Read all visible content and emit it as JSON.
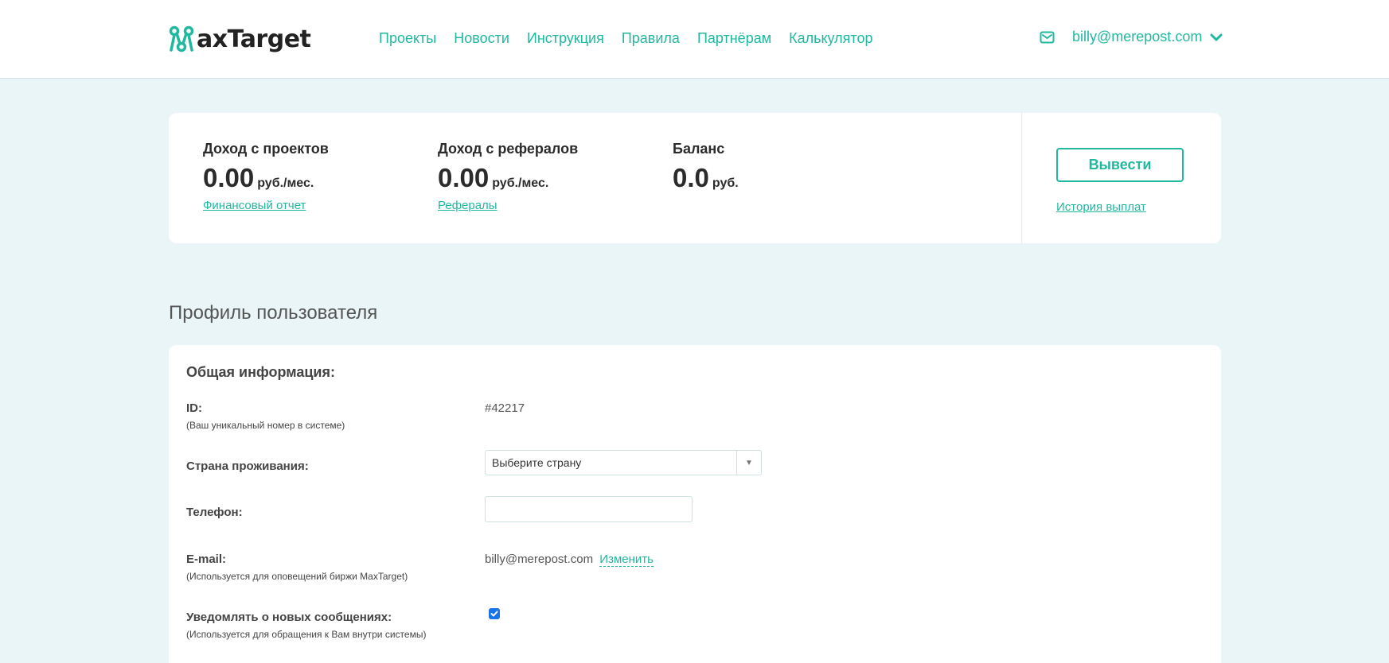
{
  "brand": {
    "logo_text": "axTarget",
    "accent": "#21b8a0",
    "page_bg": "#e9f5f6"
  },
  "nav": {
    "items": [
      {
        "label": "Проекты"
      },
      {
        "label": "Новости"
      },
      {
        "label": "Инструкция"
      },
      {
        "label": "Правила"
      },
      {
        "label": "Партнёрам"
      },
      {
        "label": "Калькулятор"
      }
    ]
  },
  "user": {
    "email": "billy@merepost.com",
    "mail_icon": "envelope-icon",
    "dropdown_icon": "chevron-down-icon"
  },
  "stats": {
    "projects": {
      "label": "Доход с проектов",
      "value": "0.00",
      "unit": "руб./мес.",
      "link": "Финансовый отчет"
    },
    "referrals": {
      "label": "Доход с рефералов",
      "value": "0.00",
      "unit": "руб./мес.",
      "link": "Рефералы"
    },
    "balance": {
      "label": "Баланс",
      "value": "0.0",
      "unit": "руб."
    },
    "withdraw_label": "Вывести",
    "history_link": "История выплат"
  },
  "profile": {
    "title": "Профиль пользователя",
    "section_title": "Общая информация:",
    "id": {
      "label": "ID:",
      "hint": "(Ваш уникальный номер в системе)",
      "value": "#42217"
    },
    "country": {
      "label": "Страна проживания:",
      "selected": "Выберите страну"
    },
    "phone": {
      "label": "Телефон:",
      "value": ""
    },
    "email": {
      "label": "E-mail:",
      "hint": "(Используется для оповещений биржи MaxTarget)",
      "value": "billy@merepost.com",
      "change_link": "Изменить"
    },
    "notify": {
      "label": "Уведомлять о новых сообщениях:",
      "hint": "(Используется для обращения к Вам внутри системы)",
      "checked": true
    }
  }
}
